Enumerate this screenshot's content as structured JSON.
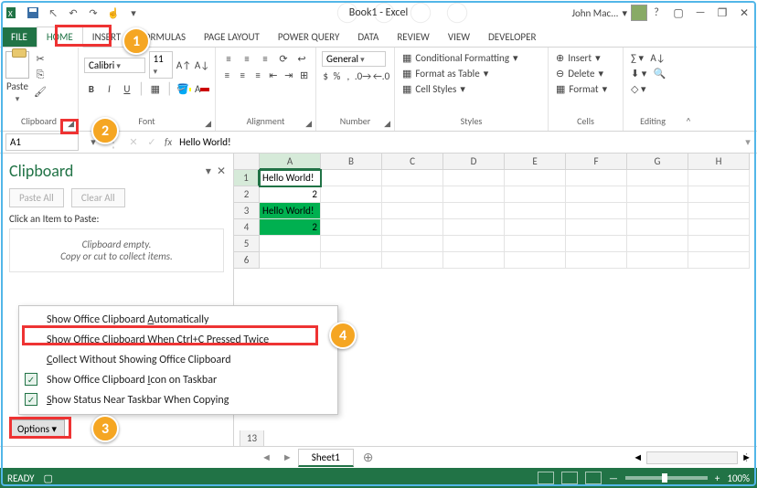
{
  "titlebar": {
    "title": "Book1 - Excel",
    "user": "John Mac..."
  },
  "tabs": [
    "FILE",
    "HOME",
    "INSERT",
    "FORMULAS",
    "PAGE LAYOUT",
    "POWER QUERY",
    "DATA",
    "REVIEW",
    "VIEW",
    "DEVELOPER"
  ],
  "ribbon": {
    "clipboard": {
      "paste": "Paste",
      "label": "Clipboard"
    },
    "font": {
      "name": "Calibri",
      "size": "11",
      "label": "Font"
    },
    "alignment": {
      "label": "Alignment"
    },
    "number": {
      "format": "General",
      "label": "Number"
    },
    "styles": {
      "cond": "Conditional Formatting",
      "table": "Format as Table",
      "cell": "Cell Styles",
      "label": "Styles"
    },
    "cells": {
      "insert": "Insert",
      "delete": "Delete",
      "format": "Format",
      "label": "Cells"
    },
    "editing": {
      "label": "Editing"
    }
  },
  "formula": {
    "namebox": "A1",
    "value": "Hello World!"
  },
  "clipboard_panel": {
    "title": "Clipboard",
    "paste_all": "Paste All",
    "clear_all": "Clear All",
    "hint": "Click an Item to Paste:",
    "empty1": "Clipboard empty.",
    "empty2": "Copy or cut to collect items.",
    "options": "Options"
  },
  "options_menu": {
    "items": [
      {
        "label": "Show Office Clipboard Automatically",
        "u": "A",
        "checked": false
      },
      {
        "label": "Show Office Clipboard When Ctrl+C Pressed Twice",
        "u": "P",
        "checked": false
      },
      {
        "label": "Collect Without Showing Office Clipboard",
        "u": "C",
        "checked": false
      },
      {
        "label": "Show Office Clipboard Icon on Taskbar",
        "u": "I",
        "checked": true
      },
      {
        "label": "Show Status Near Taskbar When Copying",
        "u": "S",
        "checked": true
      }
    ]
  },
  "sheet": {
    "columns": [
      "A",
      "B",
      "C",
      "D",
      "E",
      "F",
      "G",
      "H"
    ],
    "rows": [
      {
        "n": 1,
        "cells": [
          "Hello World!",
          "",
          "",
          "",
          "",
          "",
          "",
          ""
        ]
      },
      {
        "n": 2,
        "cells": [
          "2",
          "",
          "",
          "",
          "",
          "",
          "",
          ""
        ]
      },
      {
        "n": 3,
        "cells": [
          "Hello World!",
          "",
          "",
          "",
          "",
          "",
          "",
          ""
        ]
      },
      {
        "n": 4,
        "cells": [
          "2",
          "",
          "",
          "",
          "",
          "",
          "",
          ""
        ]
      },
      {
        "n": 5,
        "cells": [
          "",
          "",
          "",
          "",
          "",
          "",
          "",
          ""
        ]
      },
      {
        "n": 6,
        "cells": [
          "",
          "",
          "",
          "",
          "",
          "",
          "",
          ""
        ]
      }
    ],
    "extra_row": "13",
    "tab": "Sheet1"
  },
  "status": {
    "ready": "READY",
    "zoom": "100%"
  },
  "callouts": {
    "1": "1",
    "2": "2",
    "3": "3",
    "4": "4"
  }
}
